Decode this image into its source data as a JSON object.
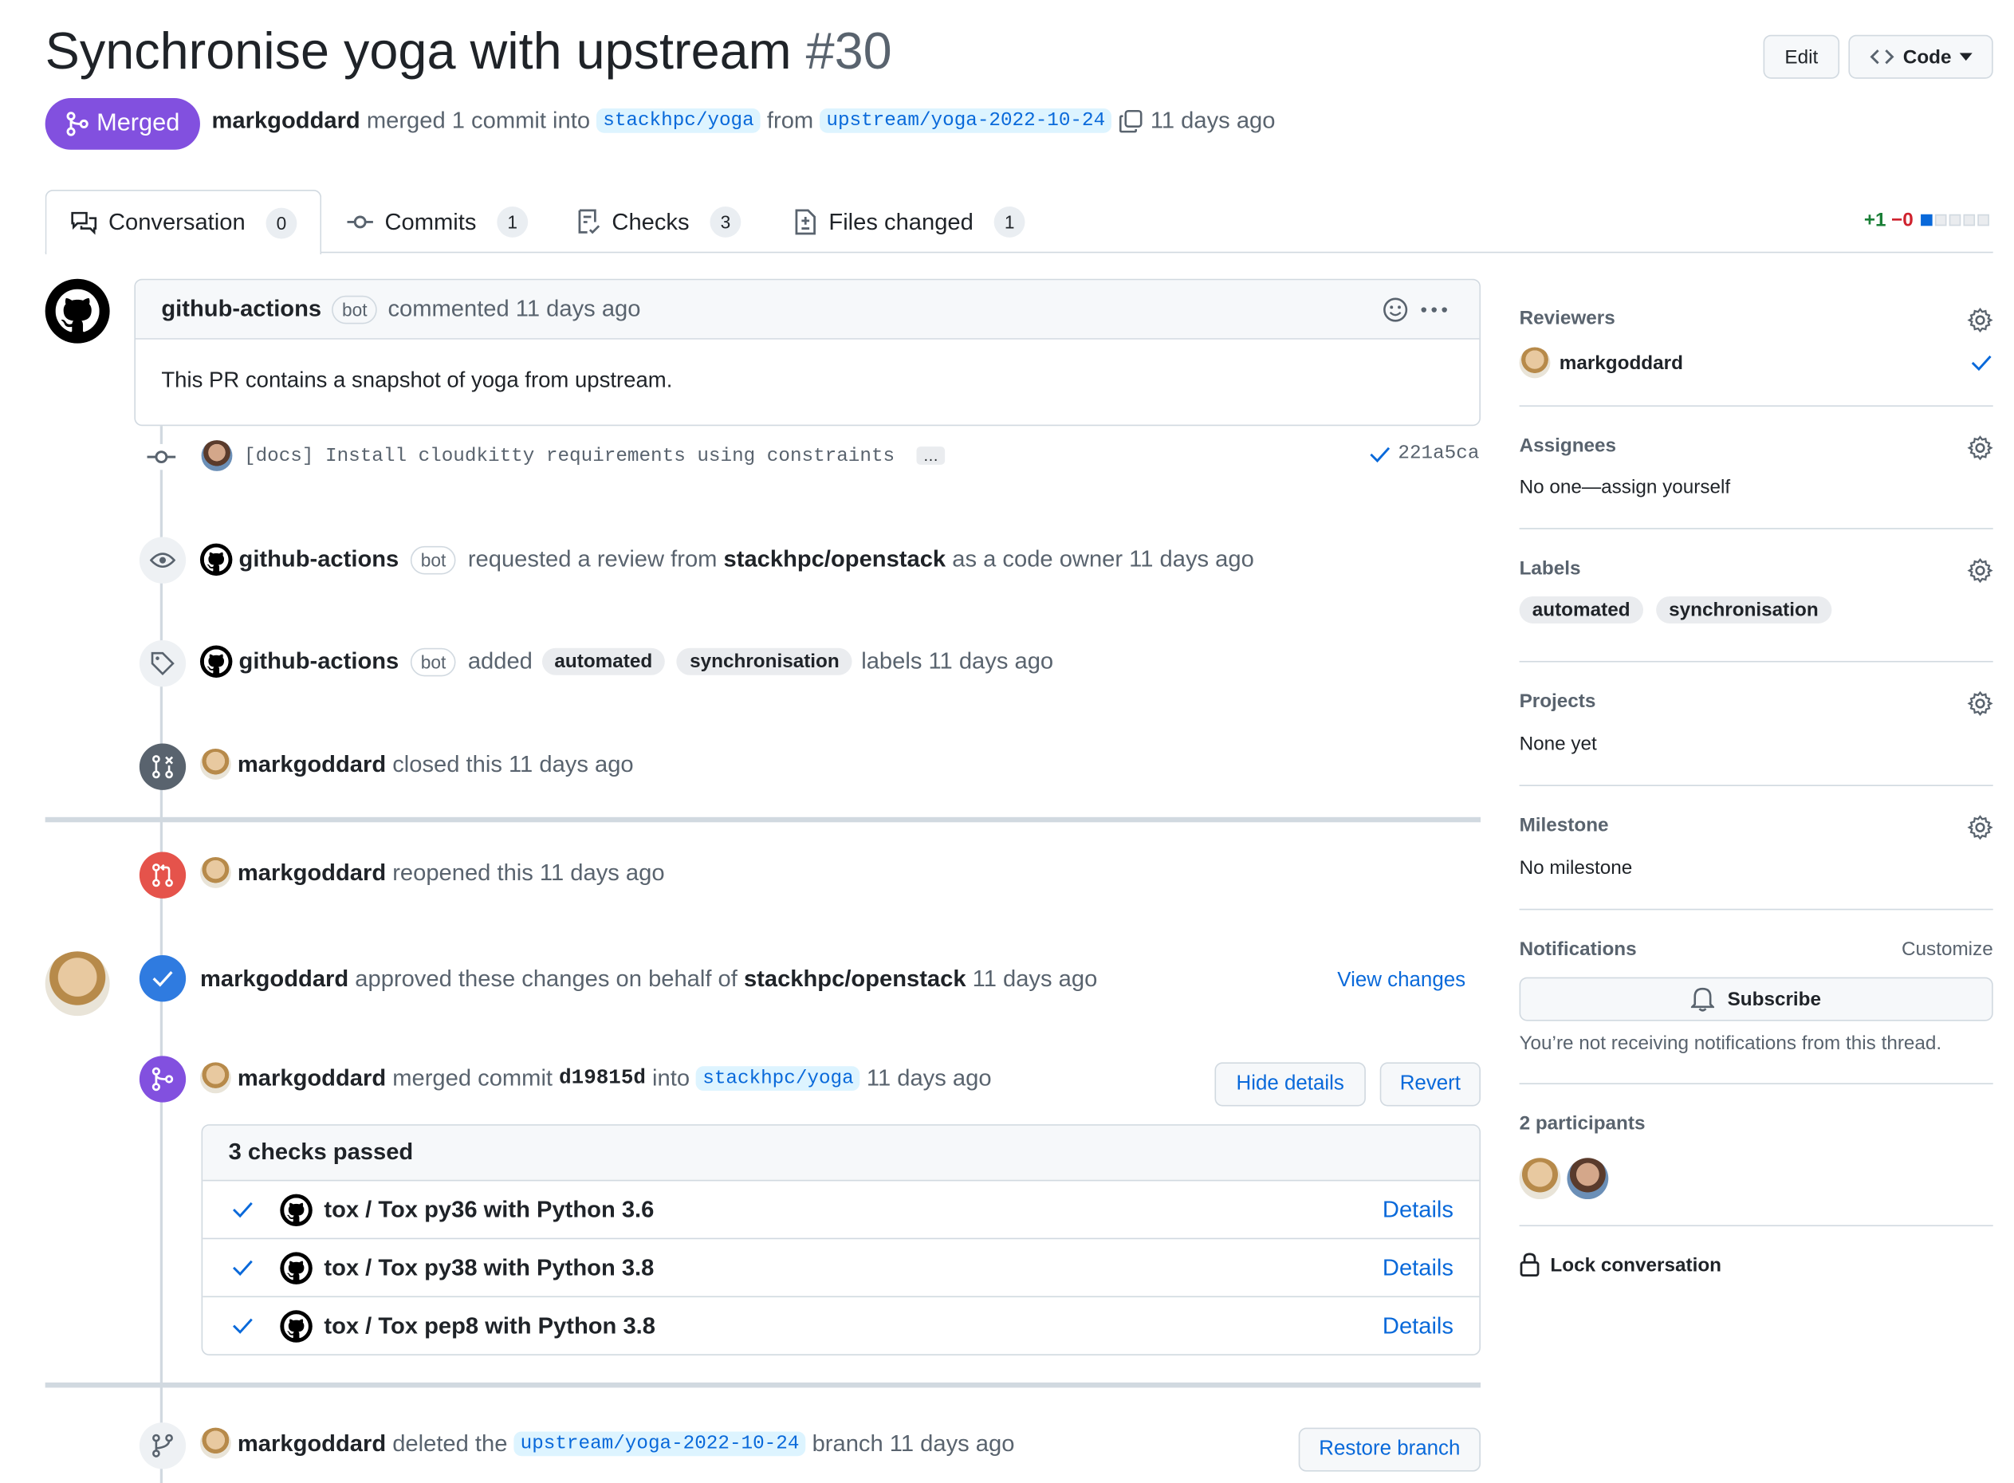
{
  "pr": {
    "title": "Synchronise yoga with upstream",
    "number": "#30",
    "state": "Merged",
    "author": "markgoddard",
    "merged_text": "merged 1 commit into",
    "base": "stackhpc/yoga",
    "from": "from",
    "head": "upstream/yoga-2022-10-24",
    "time": "11 days ago"
  },
  "header_buttons": {
    "edit": "Edit",
    "code": "Code"
  },
  "tabs": [
    {
      "label": "Conversation",
      "count": "0"
    },
    {
      "label": "Commits",
      "count": "1"
    },
    {
      "label": "Checks",
      "count": "3"
    },
    {
      "label": "Files changed",
      "count": "1"
    }
  ],
  "diffstat": {
    "add": "+1",
    "del": "−0"
  },
  "comment": {
    "author": "github-actions",
    "bot": "bot",
    "action": "commented 11 days ago",
    "body": "This PR contains a snapshot of yoga from upstream."
  },
  "commit": {
    "message": "[docs] Install cloudkitty requirements using constraints",
    "more": "…",
    "sha": "221a5ca"
  },
  "events": {
    "review_request": {
      "actor": "github-actions",
      "bot": "bot",
      "pre": "requested a review from",
      "team": "stackhpc/openstack",
      "post": "as a code owner 11 days ago"
    },
    "labeled": {
      "actor": "github-actions",
      "bot": "bot",
      "pre": "added",
      "l1": "automated",
      "l2": "synchronisation",
      "post": "labels 11 days ago"
    },
    "closed": {
      "actor": "markgoddard",
      "text": "closed this 11 days ago"
    },
    "reopened": {
      "actor": "markgoddard",
      "text": "reopened this 11 days ago"
    },
    "approved": {
      "actor": "markgoddard",
      "pre": "approved these changes on behalf of",
      "team": "stackhpc/openstack",
      "post": "11 days ago",
      "link": "View changes"
    },
    "merged": {
      "actor": "markgoddard",
      "pre": "merged commit",
      "sha": "d19815d",
      "mid": "into",
      "branch": "stackhpc/yoga",
      "post": "11 days ago",
      "hide": "Hide details",
      "revert": "Revert"
    },
    "deleted": {
      "actor": "markgoddard",
      "pre": "deleted the",
      "branch": "upstream/yoga-2022-10-24",
      "post": "branch 11 days ago",
      "restore": "Restore branch"
    }
  },
  "checks": {
    "title": "3 checks passed",
    "items": [
      {
        "name": "tox / Tox py36 with Python 3.6",
        "link": "Details"
      },
      {
        "name": "tox / Tox py38 with Python 3.8",
        "link": "Details"
      },
      {
        "name": "tox / Tox pep8 with Python 3.8",
        "link": "Details"
      }
    ]
  },
  "sidebar": {
    "reviewers": {
      "title": "Reviewers",
      "name": "markgoddard"
    },
    "assignees": {
      "title": "Assignees",
      "value": "No one—assign yourself"
    },
    "labels": {
      "title": "Labels",
      "items": [
        "automated",
        "synchronisation"
      ]
    },
    "projects": {
      "title": "Projects",
      "value": "None yet"
    },
    "milestone": {
      "title": "Milestone",
      "value": "No milestone"
    },
    "notifications": {
      "title": "Notifications",
      "customize": "Customize",
      "subscribe": "Subscribe",
      "note": "You’re not receiving notifications from this thread."
    },
    "participants": {
      "title": "2 participants"
    },
    "lock": "Lock conversation"
  },
  "colors": {
    "merged": "#8250df",
    "closed": "#cf222e",
    "closed_icon": "#59636e",
    "approved": "#0969da",
    "link": "#0969da"
  }
}
